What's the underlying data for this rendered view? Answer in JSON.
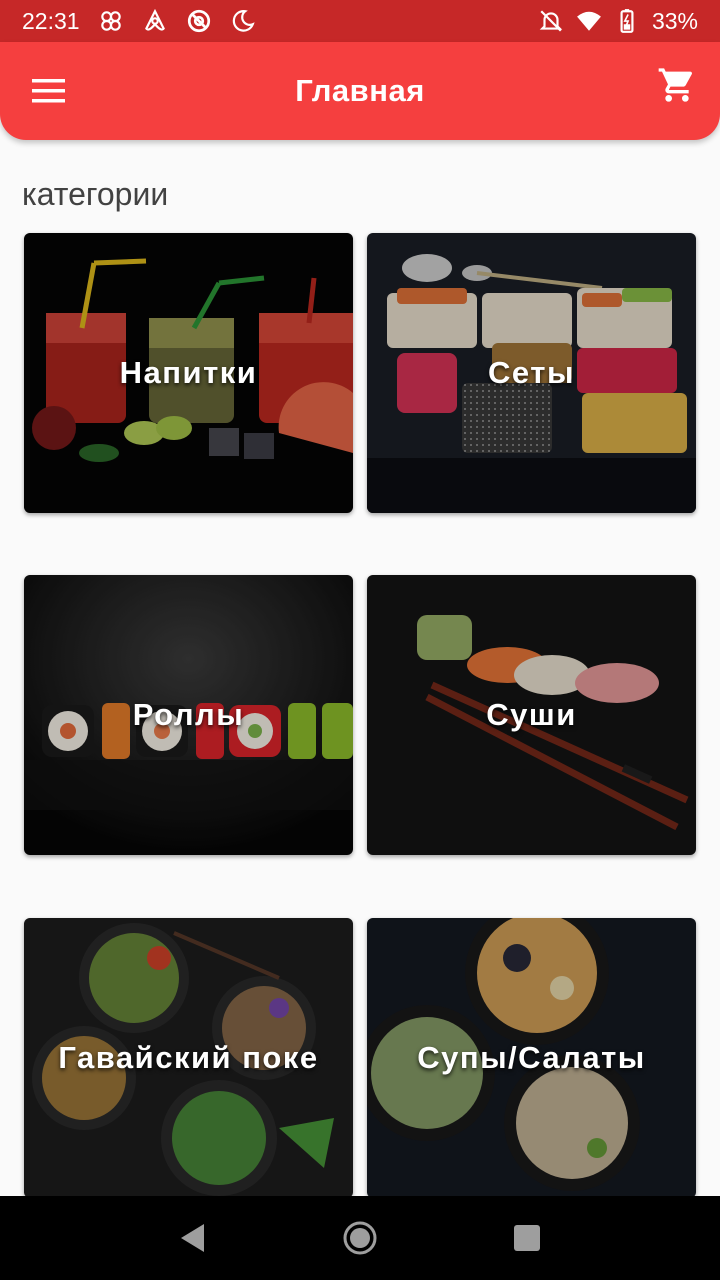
{
  "status_bar": {
    "time": "22:31",
    "battery": "33%",
    "icons": [
      "pinwheel-icon",
      "airbnb-icon",
      "at-sign-icon",
      "moon-icon",
      "bell-off-icon",
      "wifi-icon",
      "battery-icon"
    ]
  },
  "app_bar": {
    "title": "Главная",
    "menu_icon": "menu-icon",
    "cart_icon": "cart-icon",
    "color": "#f53f3f"
  },
  "main": {
    "section_title": "категории",
    "categories": [
      {
        "label": "Напитки"
      },
      {
        "label": "Сеты"
      },
      {
        "label": "Роллы"
      },
      {
        "label": "Суши"
      },
      {
        "label": "Гавайский поке"
      },
      {
        "label": "Супы/Салаты"
      }
    ]
  },
  "nav_bar": {
    "icons": [
      "back-icon",
      "home-icon",
      "recents-icon"
    ]
  }
}
